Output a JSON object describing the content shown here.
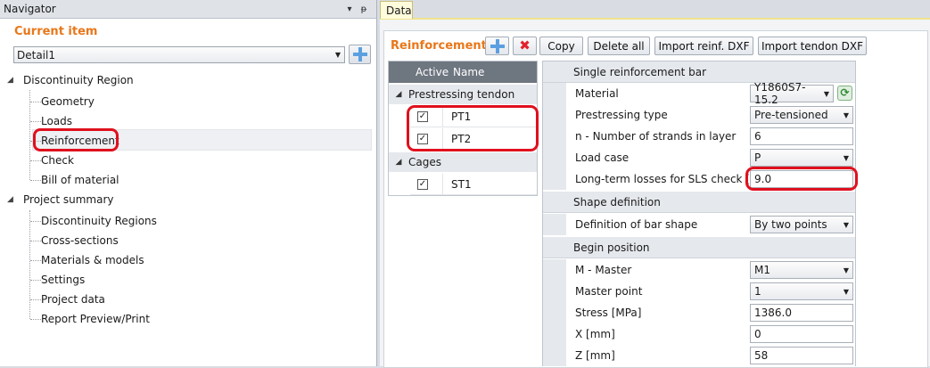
{
  "navigator": {
    "title": "Navigator",
    "pin_glyph": "▾",
    "unpin_glyph": "ᵽ",
    "current_item_label": "Current item",
    "current_item_value": "Detail1",
    "tree": {
      "discontinuity_region": "Discontinuity Region",
      "dr_children": [
        "Geometry",
        "Loads",
        "Reinforcement",
        "Check",
        "Bill of material"
      ],
      "project_summary": "Project summary",
      "ps_children": [
        "Discontinuity Regions",
        "Cross-sections",
        "Materials & models",
        "Settings",
        "Project data",
        "Report Preview/Print"
      ]
    }
  },
  "data_tab": {
    "label": "Data"
  },
  "toolbar": {
    "title": "Reinforcement",
    "copy": "Copy",
    "delete_all": "Delete all",
    "import_reinf": "Import reinf. DXF",
    "import_tendon": "Import tendon DXF"
  },
  "list": {
    "col_active": "Active",
    "col_name": "Name",
    "groups": [
      {
        "label": "Prestressing tendon",
        "items": [
          {
            "name": "PT1",
            "checked": true
          },
          {
            "name": "PT2",
            "checked": true
          }
        ]
      },
      {
        "label": "Cages",
        "items": [
          {
            "name": "ST1",
            "checked": true
          }
        ]
      }
    ]
  },
  "grid": {
    "cat_single": "Single reinforcement bar",
    "material_label": "Material",
    "material_value": "Y1860S7-15.2",
    "prestress_type_label": "Prestressing type",
    "prestress_type_value": "Pre-tensioned",
    "strands_label": "n - Number of strands in layer",
    "strands_value": "6",
    "load_case_label": "Load case",
    "load_case_value": "P",
    "losses_label": "Long-term losses for SLS check [%]",
    "losses_value": "9.0",
    "cat_shape": "Shape definition",
    "shape_label": "Definition of bar shape",
    "shape_value": "By two points",
    "cat_begin": "Begin position",
    "master_label": "M - Master",
    "master_value": "M1",
    "master_point_label": "Master point",
    "master_point_value": "1",
    "stress_label": "Stress [MPa]",
    "stress_value": "1386.0",
    "x_label": "X [mm]",
    "x_value": "0",
    "z_label": "Z [mm]",
    "z_value": "58"
  },
  "colors": {
    "accent_orange": "#e8771a",
    "highlight_red": "#e0101e",
    "header_gray": "#6e7680"
  }
}
